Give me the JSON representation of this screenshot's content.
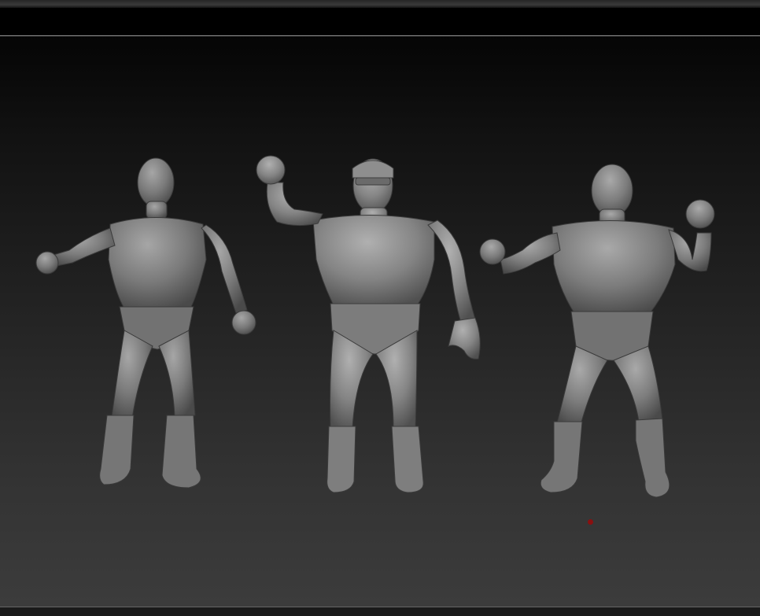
{
  "viewport": {
    "background_top": "#050505",
    "background_bottom": "#3c3c3c"
  },
  "figures": [
    {
      "name": "left-wrestler",
      "color": "#7c7c7c"
    },
    {
      "name": "center-wrestler",
      "color": "#868686"
    },
    {
      "name": "right-wrestler",
      "color": "#7e7e7e"
    }
  ],
  "marker": {
    "color": "#8a1010"
  }
}
